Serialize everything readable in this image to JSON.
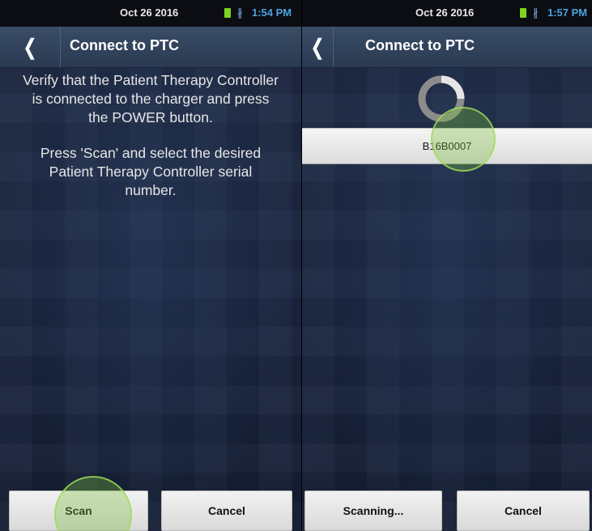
{
  "left": {
    "status": {
      "date": "Oct 26 2016",
      "time": "1:54 PM"
    },
    "header": {
      "back_glyph": "❬",
      "title": "Connect to PTC"
    },
    "instructions": {
      "p1": [
        "Verify that the Patient Therapy Controller",
        "is connected to the charger and press",
        "the POWER button."
      ],
      "p2": [
        "Press 'Scan' and select the desired",
        "Patient Therapy Controller serial",
        "number."
      ]
    },
    "buttons": {
      "scan": "Scan",
      "cancel": "Cancel"
    }
  },
  "right": {
    "status": {
      "date": "Oct 26 2016",
      "time": "1:57 PM"
    },
    "header": {
      "back_glyph": "❬",
      "title": "Connect to PTC"
    },
    "devices": [
      {
        "serial": "B16B0007"
      }
    ],
    "buttons": {
      "scanning": "Scanning...",
      "cancel": "Cancel"
    }
  },
  "colors": {
    "accent_time": "#4aa3df",
    "battery": "#7ed321",
    "touch_indicator": "#78be3c"
  },
  "icons": {
    "back": "chevron-left-icon",
    "battery": "battery-icon",
    "bluetooth": "bluetooth-icon",
    "progress": "progress-spinner-icon"
  }
}
